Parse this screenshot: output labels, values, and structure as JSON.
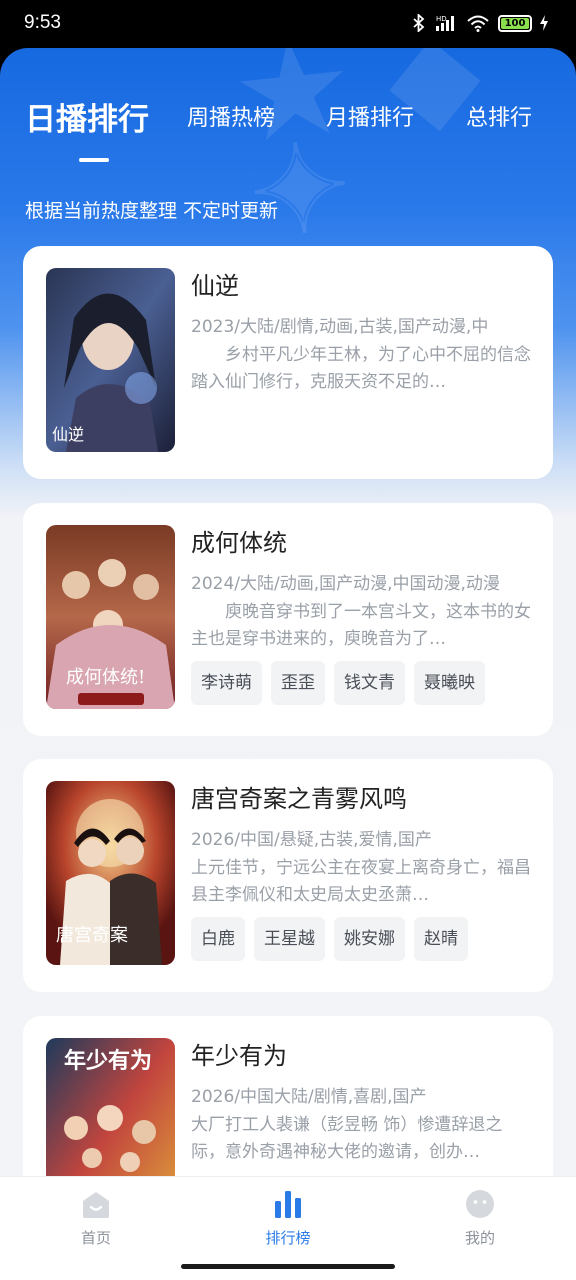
{
  "status_bar": {
    "time": "9:53",
    "battery": "100"
  },
  "tabs": [
    {
      "label": "日播排行",
      "active": true
    },
    {
      "label": "周播热榜",
      "active": false
    },
    {
      "label": "月播排行",
      "active": false
    },
    {
      "label": "总排行",
      "active": false
    }
  ],
  "subtitle": "根据当前热度整理 不定时更新",
  "cards": [
    {
      "title": "仙逆",
      "meta": "2023/大陆/剧情,动画,古装,国产动漫,中",
      "description": "乡村平凡少年王林，为了心中不屈的信念踏入仙门修行，克服天资不足的…",
      "tags": []
    },
    {
      "title": "成何体统",
      "meta": "2024/大陆/动画,国产动漫,中国动漫,动漫",
      "description": "庾晚音穿书到了一本宫斗文，这本书的女主也是穿书进来的，庾晚音为了…",
      "tags": [
        "李诗萌",
        "歪歪",
        "钱文青",
        "聂曦映"
      ]
    },
    {
      "title": "唐宫奇案之青雾风鸣",
      "meta": "2026/中国/悬疑,古装,爱情,国产",
      "description": "上元佳节，宁远公主在夜宴上离奇身亡，福昌县主李佩仪和太史局太史丞萧…",
      "tags": [
        "白鹿",
        "王星越",
        "姚安娜",
        "赵晴"
      ]
    },
    {
      "title": "年少有为",
      "meta": "2026/中国大陆/剧情,喜剧,国产",
      "description": "大厂打工人裴谦（彭昱畅 饰）惨遭辞退之际，意外奇遇神秘大佬的邀请，创办…",
      "tags": []
    }
  ],
  "bottom_nav": [
    {
      "label": "首页",
      "icon": "home-icon",
      "active": false
    },
    {
      "label": "排行榜",
      "icon": "ranking-bars-icon",
      "active": true
    },
    {
      "label": "我的",
      "icon": "profile-face-icon",
      "active": false
    }
  ],
  "colors": {
    "accent": "#2a7be8",
    "hero_blue": "#1769e0",
    "meta_gray": "#9aa0a8"
  }
}
